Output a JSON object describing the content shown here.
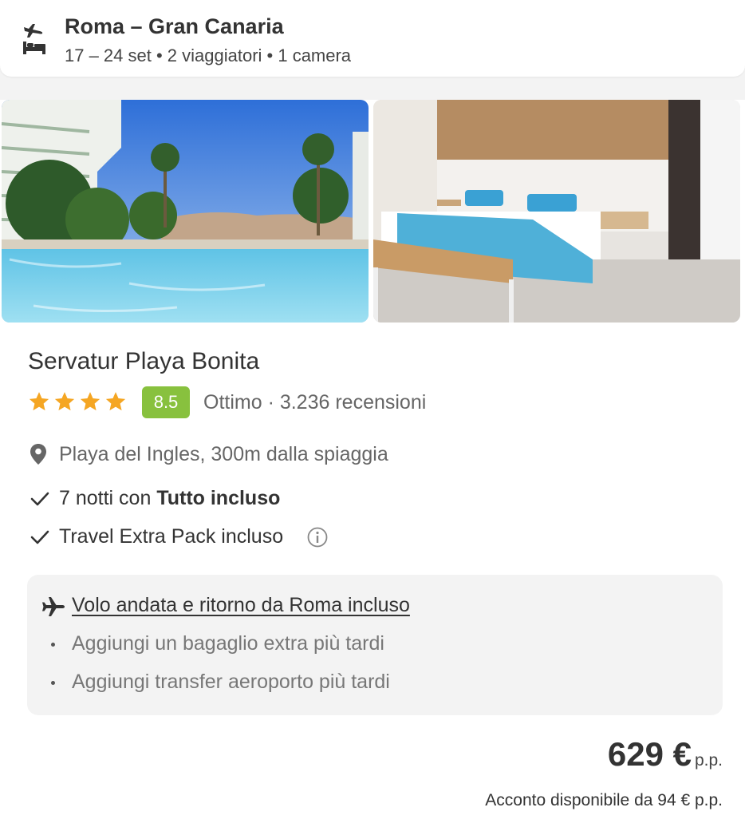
{
  "header": {
    "title": "Roma – Gran Canaria",
    "subtitle": "17 – 24 set • 2 viaggiatori • 1 camera",
    "icon": "plane-bed-icon"
  },
  "hotel": {
    "name": "Servatur Playa Bonita",
    "stars": 4,
    "score": "8.5",
    "score_color": "#88c13e",
    "star_color": "#f5a623",
    "rating_text": "Ottimo · 3.236 recensioni",
    "location": "Playa del Ingles, 300m dalla spiaggia"
  },
  "features": [
    {
      "prefix": "7 notti con ",
      "bold": "Tutto incluso"
    },
    {
      "prefix": "Travel Extra Pack incluso",
      "bold": ""
    }
  ],
  "flight": {
    "title": "Volo andata e ritorno da Roma incluso",
    "bullets": [
      "Aggiungi un bagaglio extra più tardi",
      "Aggiungi transfer aeroporto più tardi"
    ]
  },
  "price": {
    "amount": "629 €",
    "unit": "p.p.",
    "deposit": "Acconto disponibile da 94 € p.p."
  }
}
